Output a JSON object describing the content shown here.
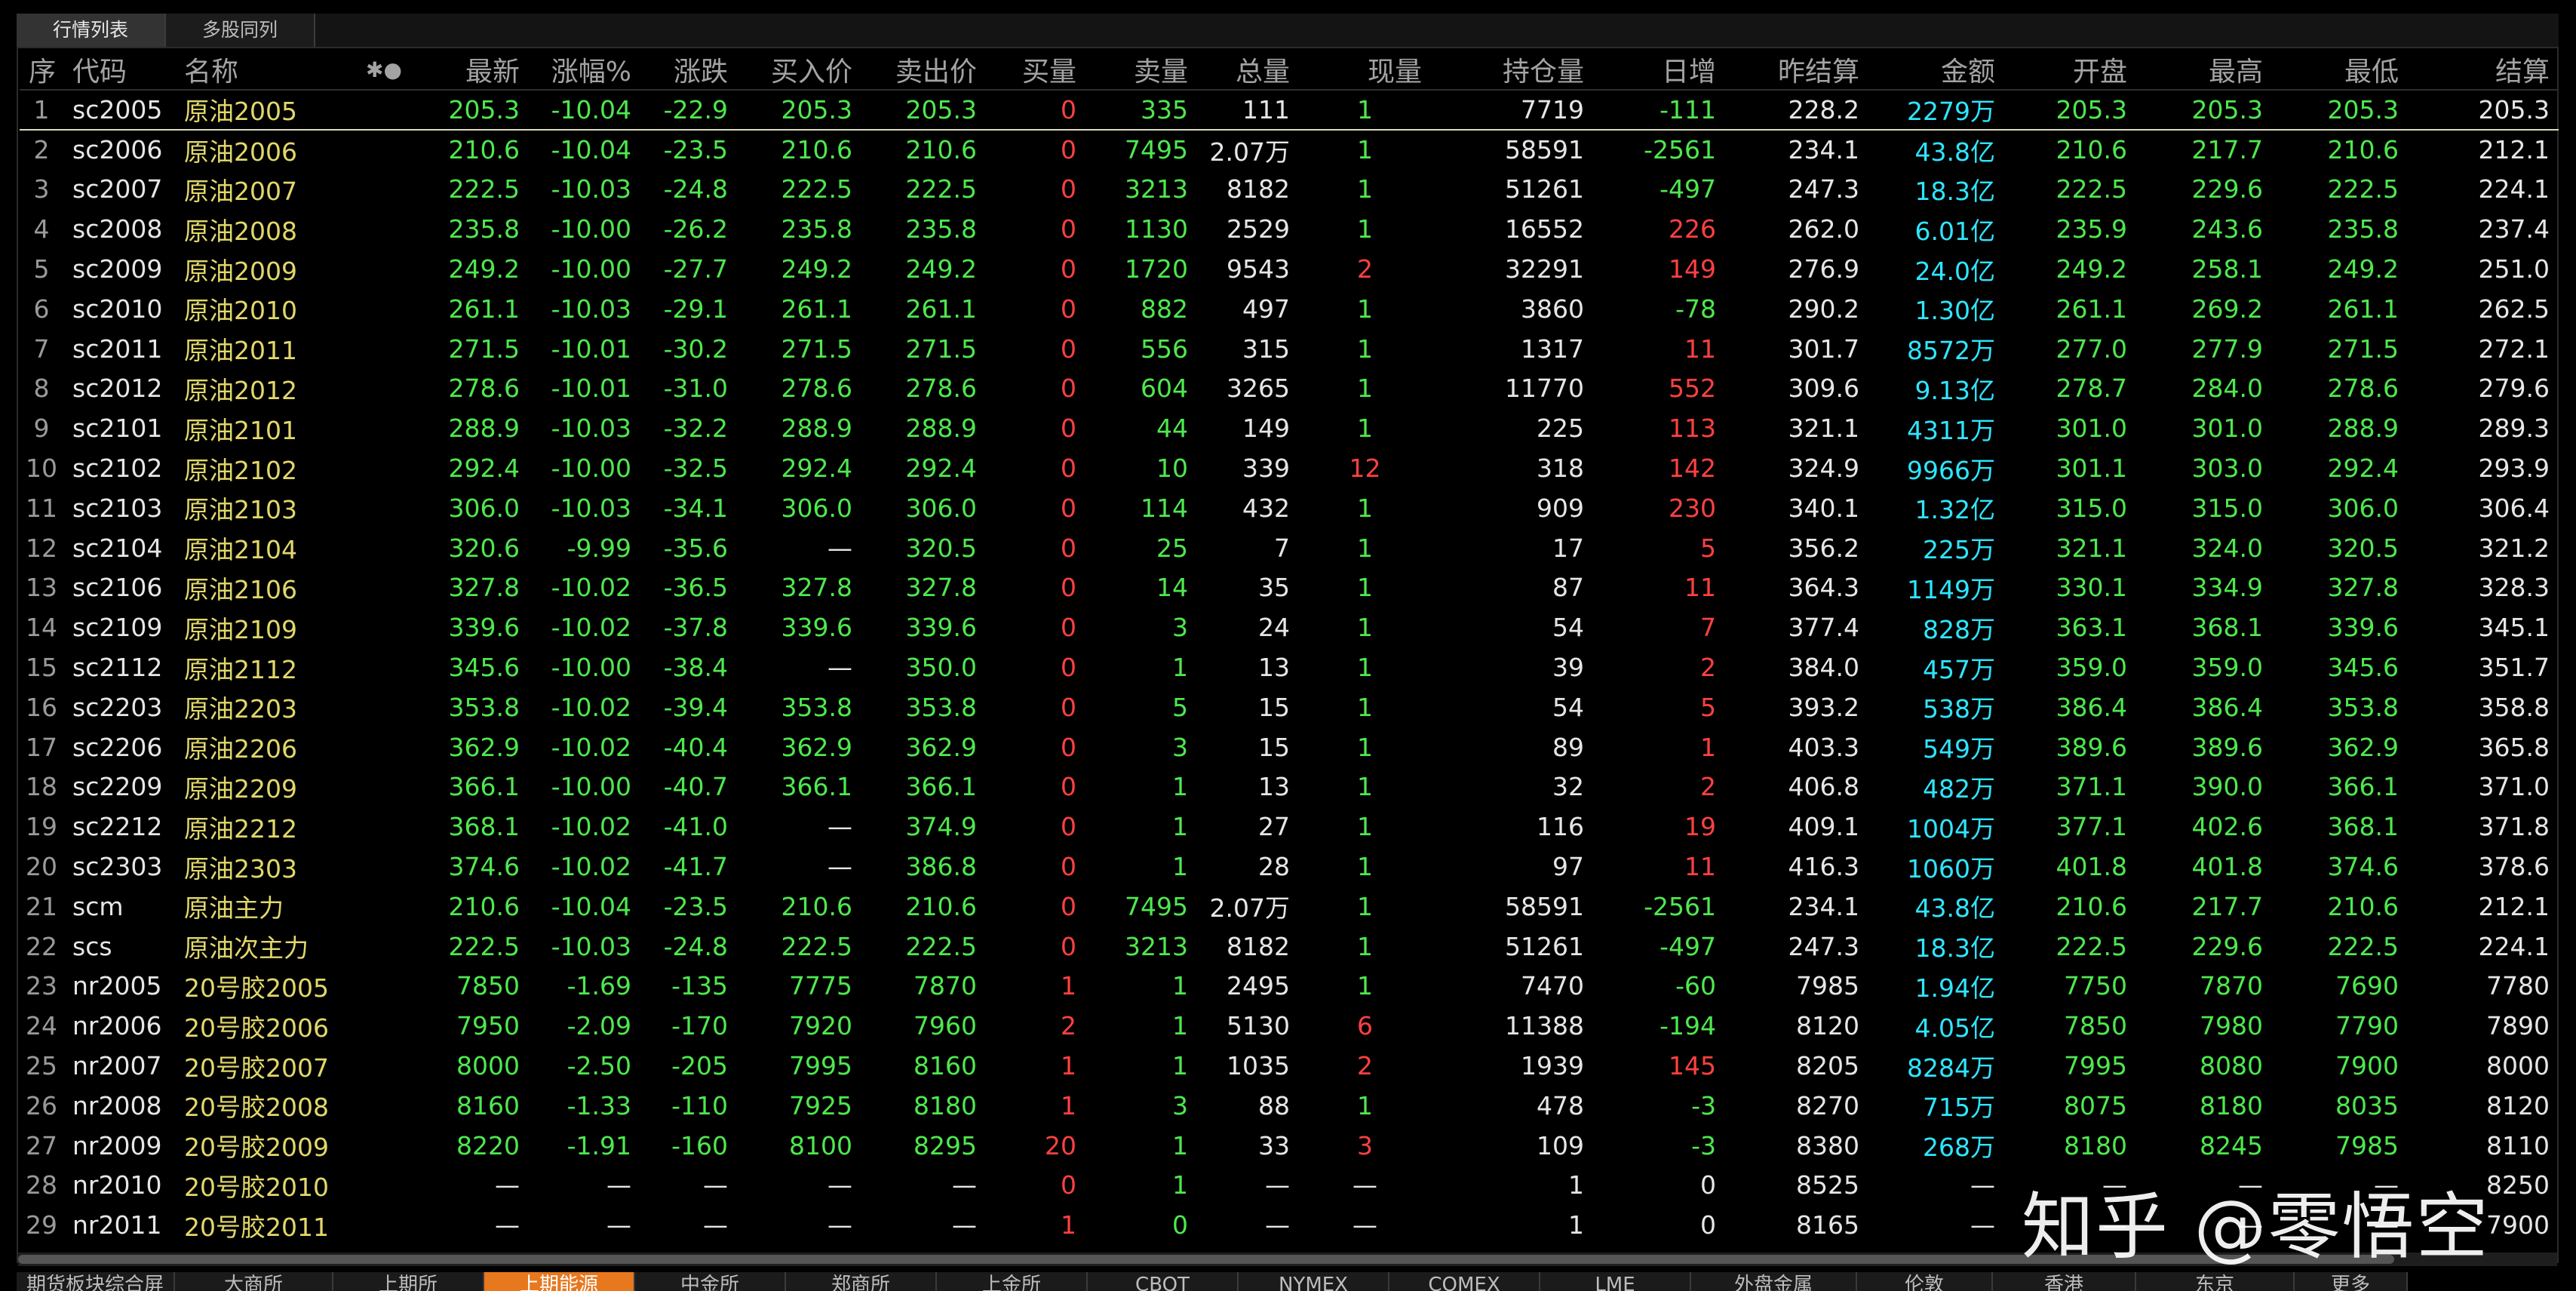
{
  "tabs": [
    {
      "label": "行情列表",
      "active": true
    },
    {
      "label": "多股同列",
      "active": false
    }
  ],
  "columns": [
    "序",
    "代码",
    "名称",
    "✱●",
    "最新",
    "涨幅%",
    "涨跌",
    "买入价",
    "卖出价",
    "买量",
    "卖量",
    "总量",
    "现量",
    "持仓量",
    "日增",
    "昨结算",
    "金额",
    "开盘",
    "最高",
    "最低",
    "结算"
  ],
  "rows": [
    {
      "idx": "1",
      "code": "sc2005",
      "name": "原油2005",
      "last": "205.3",
      "pct": "-10.04",
      "chg": "-22.9",
      "bid": "205.3",
      "ask": "205.3",
      "bidv": "0",
      "askv": "335",
      "vol": "111",
      "cur": "1",
      "oi": "7719",
      "inc": "-111",
      "pset": "228.2",
      "amt": "2279万",
      "open": "205.3",
      "high": "205.3",
      "low": "205.3",
      "set": "205.3"
    },
    {
      "idx": "2",
      "code": "sc2006",
      "name": "原油2006",
      "last": "210.6",
      "pct": "-10.04",
      "chg": "-23.5",
      "bid": "210.6",
      "ask": "210.6",
      "bidv": "0",
      "askv": "7495",
      "vol": "2.07万",
      "cur": "1",
      "oi": "58591",
      "inc": "-2561",
      "pset": "234.1",
      "amt": "43.8亿",
      "open": "210.6",
      "high": "217.7",
      "low": "210.6",
      "set": "212.1"
    },
    {
      "idx": "3",
      "code": "sc2007",
      "name": "原油2007",
      "last": "222.5",
      "pct": "-10.03",
      "chg": "-24.8",
      "bid": "222.5",
      "ask": "222.5",
      "bidv": "0",
      "askv": "3213",
      "vol": "8182",
      "cur": "1",
      "oi": "51261",
      "inc": "-497",
      "pset": "247.3",
      "amt": "18.3亿",
      "open": "222.5",
      "high": "229.6",
      "low": "222.5",
      "set": "224.1"
    },
    {
      "idx": "4",
      "code": "sc2008",
      "name": "原油2008",
      "last": "235.8",
      "pct": "-10.00",
      "chg": "-26.2",
      "bid": "235.8",
      "ask": "235.8",
      "bidv": "0",
      "askv": "1130",
      "vol": "2529",
      "cur": "1",
      "oi": "16552",
      "inc": "226",
      "pset": "262.0",
      "amt": "6.01亿",
      "open": "235.9",
      "high": "243.6",
      "low": "235.8",
      "set": "237.4"
    },
    {
      "idx": "5",
      "code": "sc2009",
      "name": "原油2009",
      "last": "249.2",
      "pct": "-10.00",
      "chg": "-27.7",
      "bid": "249.2",
      "ask": "249.2",
      "bidv": "0",
      "askv": "1720",
      "vol": "9543",
      "cur": "2",
      "oi": "32291",
      "inc": "149",
      "pset": "276.9",
      "amt": "24.0亿",
      "open": "249.2",
      "high": "258.1",
      "low": "249.2",
      "set": "251.0"
    },
    {
      "idx": "6",
      "code": "sc2010",
      "name": "原油2010",
      "last": "261.1",
      "pct": "-10.03",
      "chg": "-29.1",
      "bid": "261.1",
      "ask": "261.1",
      "bidv": "0",
      "askv": "882",
      "vol": "497",
      "cur": "1",
      "oi": "3860",
      "inc": "-78",
      "pset": "290.2",
      "amt": "1.30亿",
      "open": "261.1",
      "high": "269.2",
      "low": "261.1",
      "set": "262.5"
    },
    {
      "idx": "7",
      "code": "sc2011",
      "name": "原油2011",
      "last": "271.5",
      "pct": "-10.01",
      "chg": "-30.2",
      "bid": "271.5",
      "ask": "271.5",
      "bidv": "0",
      "askv": "556",
      "vol": "315",
      "cur": "1",
      "oi": "1317",
      "inc": "11",
      "pset": "301.7",
      "amt": "8572万",
      "open": "277.0",
      "high": "277.9",
      "low": "271.5",
      "set": "272.1"
    },
    {
      "idx": "8",
      "code": "sc2012",
      "name": "原油2012",
      "last": "278.6",
      "pct": "-10.01",
      "chg": "-31.0",
      "bid": "278.6",
      "ask": "278.6",
      "bidv": "0",
      "askv": "604",
      "vol": "3265",
      "cur": "1",
      "oi": "11770",
      "inc": "552",
      "pset": "309.6",
      "amt": "9.13亿",
      "open": "278.7",
      "high": "284.0",
      "low": "278.6",
      "set": "279.6"
    },
    {
      "idx": "9",
      "code": "sc2101",
      "name": "原油2101",
      "last": "288.9",
      "pct": "-10.03",
      "chg": "-32.2",
      "bid": "288.9",
      "ask": "288.9",
      "bidv": "0",
      "askv": "44",
      "vol": "149",
      "cur": "1",
      "oi": "225",
      "inc": "113",
      "pset": "321.1",
      "amt": "4311万",
      "open": "301.0",
      "high": "301.0",
      "low": "288.9",
      "set": "289.3"
    },
    {
      "idx": "10",
      "code": "sc2102",
      "name": "原油2102",
      "last": "292.4",
      "pct": "-10.00",
      "chg": "-32.5",
      "bid": "292.4",
      "ask": "292.4",
      "bidv": "0",
      "askv": "10",
      "vol": "339",
      "cur": "12",
      "oi": "318",
      "inc": "142",
      "pset": "324.9",
      "amt": "9966万",
      "open": "301.1",
      "high": "303.0",
      "low": "292.4",
      "set": "293.9"
    },
    {
      "idx": "11",
      "code": "sc2103",
      "name": "原油2103",
      "last": "306.0",
      "pct": "-10.03",
      "chg": "-34.1",
      "bid": "306.0",
      "ask": "306.0",
      "bidv": "0",
      "askv": "114",
      "vol": "432",
      "cur": "1",
      "oi": "909",
      "inc": "230",
      "pset": "340.1",
      "amt": "1.32亿",
      "open": "315.0",
      "high": "315.0",
      "low": "306.0",
      "set": "306.4"
    },
    {
      "idx": "12",
      "code": "sc2104",
      "name": "原油2104",
      "last": "320.6",
      "pct": "-9.99",
      "chg": "-35.6",
      "bid": "—",
      "ask": "320.5",
      "bidv": "0",
      "askv": "25",
      "vol": "7",
      "cur": "1",
      "oi": "17",
      "inc": "5",
      "pset": "356.2",
      "amt": "225万",
      "open": "321.1",
      "high": "324.0",
      "low": "320.5",
      "set": "321.2"
    },
    {
      "idx": "13",
      "code": "sc2106",
      "name": "原油2106",
      "last": "327.8",
      "pct": "-10.02",
      "chg": "-36.5",
      "bid": "327.8",
      "ask": "327.8",
      "bidv": "0",
      "askv": "14",
      "vol": "35",
      "cur": "1",
      "oi": "87",
      "inc": "11",
      "pset": "364.3",
      "amt": "1149万",
      "open": "330.1",
      "high": "334.9",
      "low": "327.8",
      "set": "328.3"
    },
    {
      "idx": "14",
      "code": "sc2109",
      "name": "原油2109",
      "last": "339.6",
      "pct": "-10.02",
      "chg": "-37.8",
      "bid": "339.6",
      "ask": "339.6",
      "bidv": "0",
      "askv": "3",
      "vol": "24",
      "cur": "1",
      "oi": "54",
      "inc": "7",
      "pset": "377.4",
      "amt": "828万",
      "open": "363.1",
      "high": "368.1",
      "low": "339.6",
      "set": "345.1"
    },
    {
      "idx": "15",
      "code": "sc2112",
      "name": "原油2112",
      "last": "345.6",
      "pct": "-10.00",
      "chg": "-38.4",
      "bid": "—",
      "ask": "350.0",
      "bidv": "0",
      "askv": "1",
      "vol": "13",
      "cur": "1",
      "oi": "39",
      "inc": "2",
      "pset": "384.0",
      "amt": "457万",
      "open": "359.0",
      "high": "359.0",
      "low": "345.6",
      "set": "351.7"
    },
    {
      "idx": "16",
      "code": "sc2203",
      "name": "原油2203",
      "last": "353.8",
      "pct": "-10.02",
      "chg": "-39.4",
      "bid": "353.8",
      "ask": "353.8",
      "bidv": "0",
      "askv": "5",
      "vol": "15",
      "cur": "1",
      "oi": "54",
      "inc": "5",
      "pset": "393.2",
      "amt": "538万",
      "open": "386.4",
      "high": "386.4",
      "low": "353.8",
      "set": "358.8"
    },
    {
      "idx": "17",
      "code": "sc2206",
      "name": "原油2206",
      "last": "362.9",
      "pct": "-10.02",
      "chg": "-40.4",
      "bid": "362.9",
      "ask": "362.9",
      "bidv": "0",
      "askv": "3",
      "vol": "15",
      "cur": "1",
      "oi": "89",
      "inc": "1",
      "pset": "403.3",
      "amt": "549万",
      "open": "389.6",
      "high": "389.6",
      "low": "362.9",
      "set": "365.8"
    },
    {
      "idx": "18",
      "code": "sc2209",
      "name": "原油2209",
      "last": "366.1",
      "pct": "-10.00",
      "chg": "-40.7",
      "bid": "366.1",
      "ask": "366.1",
      "bidv": "0",
      "askv": "1",
      "vol": "13",
      "cur": "1",
      "oi": "32",
      "inc": "2",
      "pset": "406.8",
      "amt": "482万",
      "open": "371.1",
      "high": "390.0",
      "low": "366.1",
      "set": "371.0"
    },
    {
      "idx": "19",
      "code": "sc2212",
      "name": "原油2212",
      "last": "368.1",
      "pct": "-10.02",
      "chg": "-41.0",
      "bid": "—",
      "ask": "374.9",
      "bidv": "0",
      "askv": "1",
      "vol": "27",
      "cur": "1",
      "oi": "116",
      "inc": "19",
      "pset": "409.1",
      "amt": "1004万",
      "open": "377.1",
      "high": "402.6",
      "low": "368.1",
      "set": "371.8"
    },
    {
      "idx": "20",
      "code": "sc2303",
      "name": "原油2303",
      "last": "374.6",
      "pct": "-10.02",
      "chg": "-41.7",
      "bid": "—",
      "ask": "386.8",
      "bidv": "0",
      "askv": "1",
      "vol": "28",
      "cur": "1",
      "oi": "97",
      "inc": "11",
      "pset": "416.3",
      "amt": "1060万",
      "open": "401.8",
      "high": "401.8",
      "low": "374.6",
      "set": "378.6"
    },
    {
      "idx": "21",
      "code": "scm",
      "name": "原油主力",
      "last": "210.6",
      "pct": "-10.04",
      "chg": "-23.5",
      "bid": "210.6",
      "ask": "210.6",
      "bidv": "0",
      "askv": "7495",
      "vol": "2.07万",
      "cur": "1",
      "oi": "58591",
      "inc": "-2561",
      "pset": "234.1",
      "amt": "43.8亿",
      "open": "210.6",
      "high": "217.7",
      "low": "210.6",
      "set": "212.1"
    },
    {
      "idx": "22",
      "code": "scs",
      "name": "原油次主力",
      "last": "222.5",
      "pct": "-10.03",
      "chg": "-24.8",
      "bid": "222.5",
      "ask": "222.5",
      "bidv": "0",
      "askv": "3213",
      "vol": "8182",
      "cur": "1",
      "oi": "51261",
      "inc": "-497",
      "pset": "247.3",
      "amt": "18.3亿",
      "open": "222.5",
      "high": "229.6",
      "low": "222.5",
      "set": "224.1"
    },
    {
      "idx": "23",
      "code": "nr2005",
      "name": "20号胶2005",
      "last": "7850",
      "pct": "-1.69",
      "chg": "-135",
      "bid": "7775",
      "ask": "7870",
      "bidv": "1",
      "askv": "1",
      "vol": "2495",
      "cur": "1",
      "oi": "7470",
      "inc": "-60",
      "pset": "7985",
      "amt": "1.94亿",
      "open": "7750",
      "high": "7870",
      "low": "7690",
      "set": "7780"
    },
    {
      "idx": "24",
      "code": "nr2006",
      "name": "20号胶2006",
      "last": "7950",
      "pct": "-2.09",
      "chg": "-170",
      "bid": "7920",
      "ask": "7960",
      "bidv": "2",
      "askv": "1",
      "vol": "5130",
      "cur": "6",
      "oi": "11388",
      "inc": "-194",
      "pset": "8120",
      "amt": "4.05亿",
      "open": "7850",
      "high": "7980",
      "low": "7790",
      "set": "7890"
    },
    {
      "idx": "25",
      "code": "nr2007",
      "name": "20号胶2007",
      "last": "8000",
      "pct": "-2.50",
      "chg": "-205",
      "bid": "7995",
      "ask": "8160",
      "bidv": "1",
      "askv": "1",
      "vol": "1035",
      "cur": "2",
      "oi": "1939",
      "inc": "145",
      "pset": "8205",
      "amt": "8284万",
      "open": "7995",
      "high": "8080",
      "low": "7900",
      "set": "8000"
    },
    {
      "idx": "26",
      "code": "nr2008",
      "name": "20号胶2008",
      "last": "8160",
      "pct": "-1.33",
      "chg": "-110",
      "bid": "7925",
      "ask": "8180",
      "bidv": "1",
      "askv": "3",
      "vol": "88",
      "cur": "1",
      "oi": "478",
      "inc": "-3",
      "pset": "8270",
      "amt": "715万",
      "open": "8075",
      "high": "8180",
      "low": "8035",
      "set": "8120"
    },
    {
      "idx": "27",
      "code": "nr2009",
      "name": "20号胶2009",
      "last": "8220",
      "pct": "-1.91",
      "chg": "-160",
      "bid": "8100",
      "ask": "8295",
      "bidv": "20",
      "askv": "1",
      "vol": "33",
      "cur": "3",
      "oi": "109",
      "inc": "-3",
      "pset": "8380",
      "amt": "268万",
      "open": "8180",
      "high": "8245",
      "low": "7985",
      "set": "8110"
    },
    {
      "idx": "28",
      "code": "nr2010",
      "name": "20号胶2010",
      "last": "—",
      "pct": "—",
      "chg": "—",
      "bid": "—",
      "ask": "—",
      "bidv": "0",
      "askv": "1",
      "vol": "—",
      "cur": "—",
      "oi": "1",
      "inc": "0",
      "pset": "8525",
      "amt": "—",
      "open": "—",
      "high": "—",
      "low": "—",
      "set": "8250"
    },
    {
      "idx": "29",
      "code": "nr2011",
      "name": "20号胶2011",
      "last": "—",
      "pct": "—",
      "chg": "—",
      "bid": "—",
      "ask": "—",
      "bidv": "1",
      "askv": "0",
      "vol": "—",
      "cur": "—",
      "oi": "1",
      "inc": "0",
      "pset": "8165",
      "amt": "—",
      "open": "—",
      "high": "—",
      "low": "—",
      "set": "7900"
    }
  ],
  "bottom_tabs": [
    {
      "label": "期货板块综合屏",
      "active": false
    },
    {
      "label": "大商所",
      "active": false
    },
    {
      "label": "上期所",
      "active": false
    },
    {
      "label": "上期能源",
      "active": true
    },
    {
      "label": "中金所",
      "active": false
    },
    {
      "label": "郑商所",
      "active": false
    },
    {
      "label": "上金所",
      "active": false
    },
    {
      "label": "CBOT",
      "active": false
    },
    {
      "label": "NYMEX",
      "active": false
    },
    {
      "label": "COMEX",
      "active": false
    },
    {
      "label": "LME",
      "active": false
    },
    {
      "label": "外盘金属",
      "active": false
    },
    {
      "label": "伦敦",
      "active": false
    },
    {
      "label": "香港",
      "active": false
    },
    {
      "label": "东京",
      "active": false
    },
    {
      "label": "更多",
      "active": false
    }
  ],
  "watermark": "知乎 @零悟空",
  "colors": {
    "up": "#ff4040",
    "down": "#4ee84e",
    "amount": "#2ee6ff",
    "name": "#e2d86a",
    "active_tab": "#e8781e"
  }
}
